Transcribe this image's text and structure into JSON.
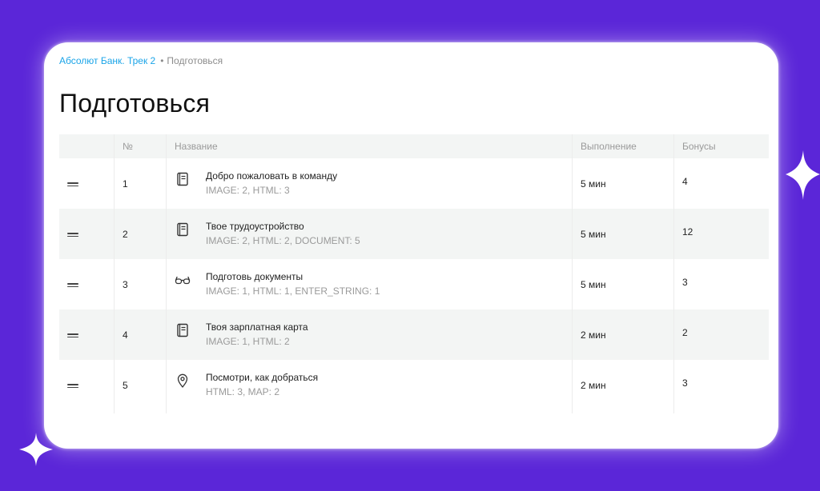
{
  "breadcrumb": {
    "parent": "Абсолют Банк. Трек 2",
    "separator": "•",
    "current": "Подготовься"
  },
  "page_title": "Подготовься",
  "table": {
    "headers": {
      "drag": "",
      "number": "№",
      "name": "Название",
      "duration": "Выполнение",
      "bonus": "Бонусы"
    },
    "rows": [
      {
        "number": "1",
        "icon": "book-icon",
        "title": "Добро пожаловать в команду",
        "subtitle": "IMAGE: 2, HTML: 3",
        "duration": "5 мин",
        "bonus": "4"
      },
      {
        "number": "2",
        "icon": "book-icon",
        "title": "Твое трудоустройство",
        "subtitle": "IMAGE: 2, HTML: 2, DOCUMENT: 5",
        "duration": "5 мин",
        "bonus": "12"
      },
      {
        "number": "3",
        "icon": "glasses-icon",
        "title": "Подготовь документы",
        "subtitle": "IMAGE: 1, HTML: 1, ENTER_STRING: 1",
        "duration": "5 мин",
        "bonus": "3"
      },
      {
        "number": "4",
        "icon": "book-icon",
        "title": "Твоя зарплатная карта",
        "subtitle": "IMAGE: 1, HTML: 2",
        "duration": "2 мин",
        "bonus": "2"
      },
      {
        "number": "5",
        "icon": "map-pin-icon",
        "title": "Посмотри, как добраться",
        "subtitle": "HTML: 3, MAP: 2",
        "duration": "2 мин",
        "bonus": "3"
      }
    ]
  },
  "colors": {
    "background": "#5b26d8",
    "card": "#ffffff",
    "link": "#1aa4e8",
    "muted": "#9a9a9a",
    "row_alt": "#f3f5f4"
  }
}
